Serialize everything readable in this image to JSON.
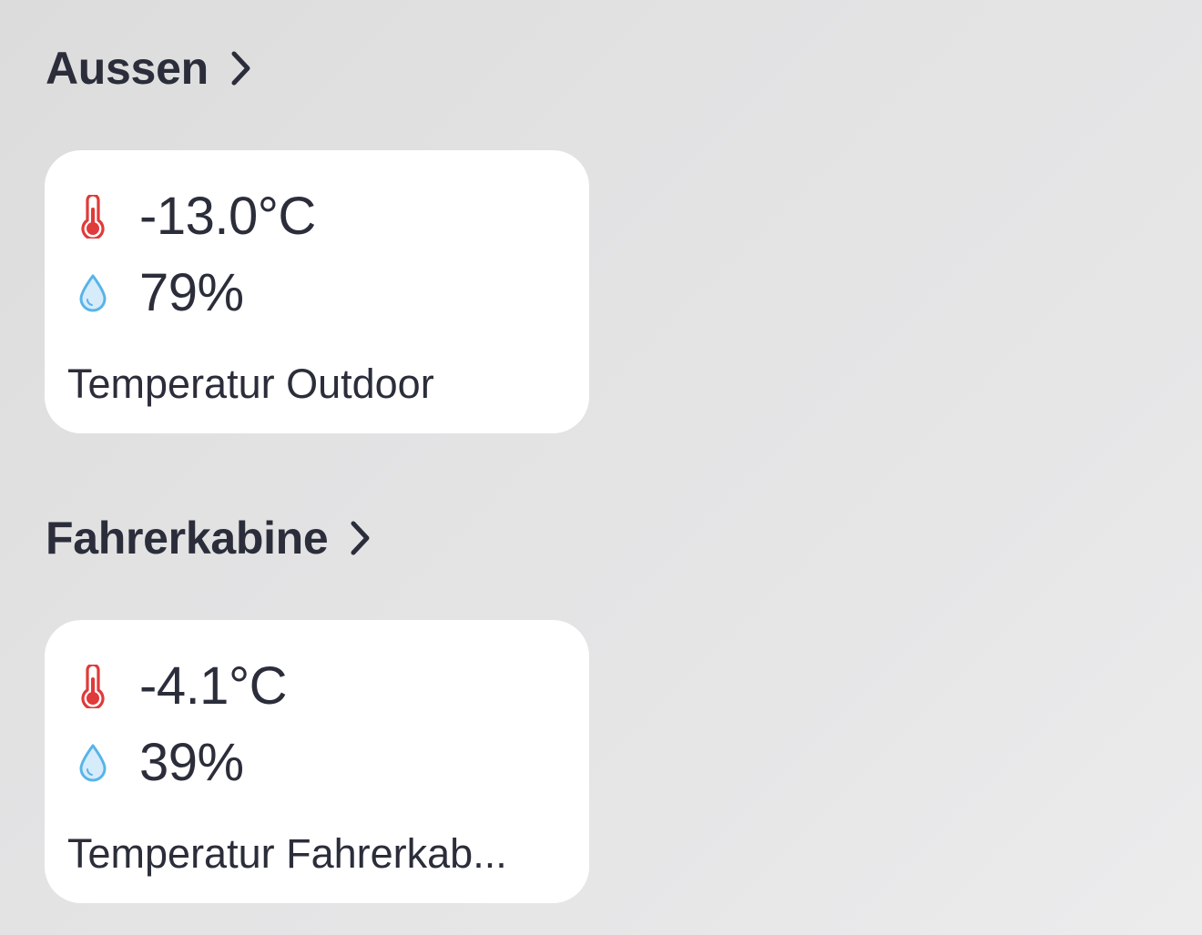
{
  "sections": [
    {
      "title": "Aussen",
      "card": {
        "temperature": "-13.0°C",
        "humidity": "79%",
        "name": "Temperatur Outdoor"
      }
    },
    {
      "title": "Fahrerkabine",
      "card": {
        "temperature": "-4.1°C",
        "humidity": "39%",
        "name": "Temperatur Fahrerkab..."
      }
    }
  ],
  "icons": {
    "temperature": "thermometer-icon",
    "humidity": "water-drop-icon",
    "navigate": "chevron-right-icon"
  },
  "colors": {
    "text": "#2b2e3a",
    "thermometer": "#e03a3a",
    "drop": "#58b4e8",
    "card": "#ffffff"
  }
}
